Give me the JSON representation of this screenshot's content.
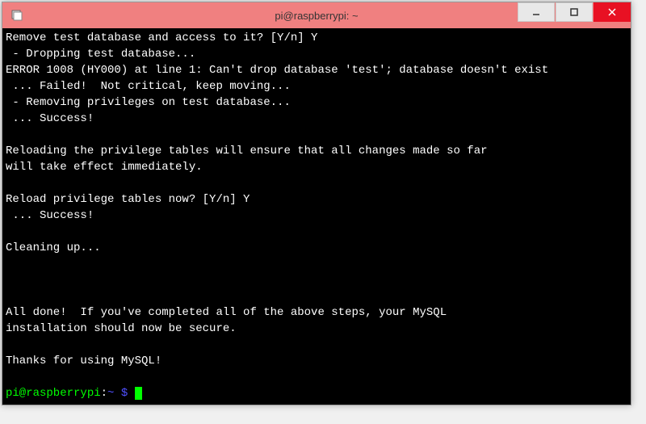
{
  "window": {
    "title": "pi@raspberrypi: ~"
  },
  "terminal": {
    "lines": [
      "Remove test database and access to it? [Y/n] Y",
      " - Dropping test database...",
      "ERROR 1008 (HY000) at line 1: Can't drop database 'test'; database doesn't exist",
      " ... Failed!  Not critical, keep moving...",
      " - Removing privileges on test database...",
      " ... Success!",
      "",
      "Reloading the privilege tables will ensure that all changes made so far",
      "will take effect immediately.",
      "",
      "Reload privilege tables now? [Y/n] Y",
      " ... Success!",
      "",
      "Cleaning up...",
      "",
      "",
      "",
      "All done!  If you've completed all of the above steps, your MySQL",
      "installation should now be secure.",
      "",
      "Thanks for using MySQL!",
      ""
    ],
    "prompt_user": "pi@raspberrypi",
    "prompt_separator": ":",
    "prompt_path": "~ $ "
  }
}
